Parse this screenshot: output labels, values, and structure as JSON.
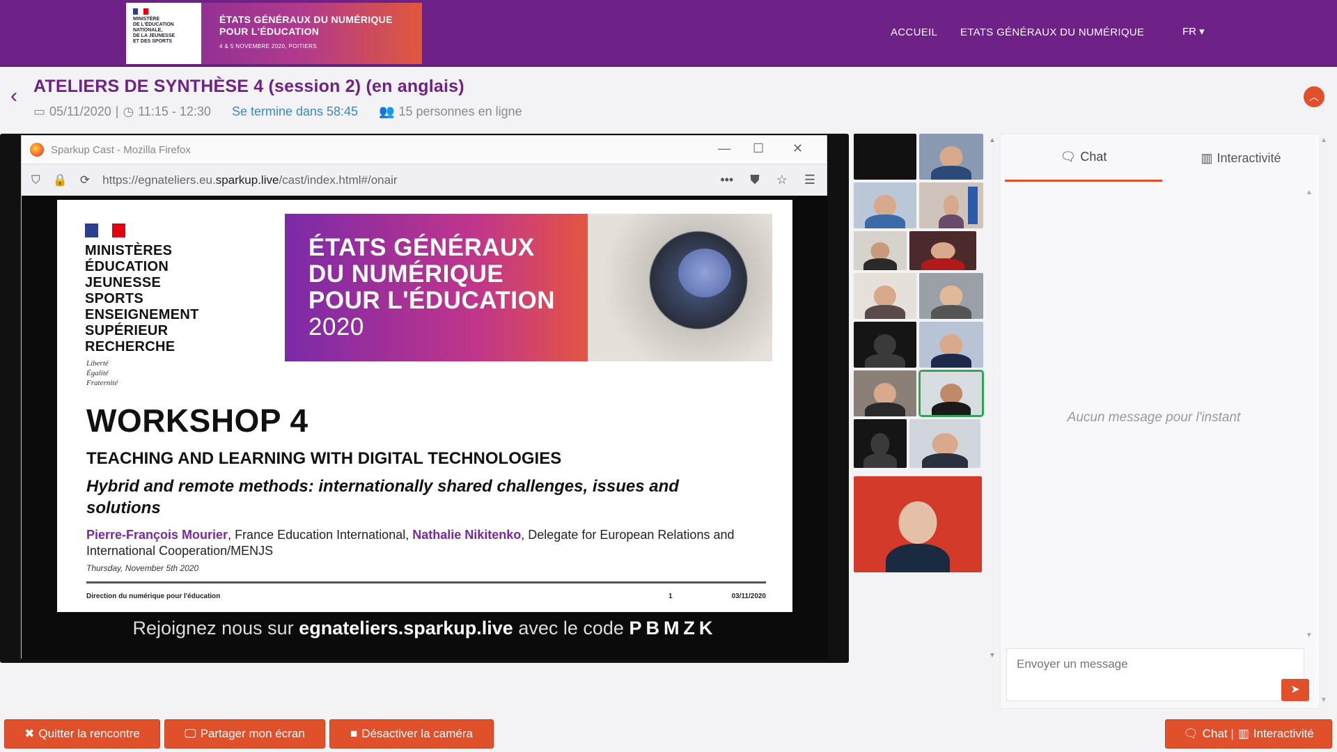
{
  "header": {
    "logo_ministry_lines": "MINISTÈRE\nDE L'ÉDUCATION\nNATIONALE,\nDE LA JEUNESSE\nET DES SPORTS",
    "logo_event_title": "ÉTATS GÉNÉRAUX DU NUMÉRIQUE\nPOUR L'ÉDUCATION",
    "logo_event_dates": "4 & 5 NOVEMBRE 2020, POITIERS",
    "nav": [
      "ACCUEIL",
      "ETATS GÉNÉRAUX DU NUMÉRIQUE"
    ],
    "lang": "FR ▾"
  },
  "session": {
    "title": "ATELIERS DE SYNTHÈSE 4 (session 2) (en anglais)",
    "date": "05/11/2020",
    "time": "11:15 - 12:30",
    "countdown": "Se termine dans 58:45",
    "online": "15 personnes en ligne"
  },
  "browser": {
    "window_title": "Sparkup Cast - Mozilla Firefox",
    "url_prefix": "https://egnateliers.eu.",
    "url_domain": "sparkup.live",
    "url_suffix": "/cast/index.html#/onair"
  },
  "slide": {
    "ministries": "MINISTÈRES\nÉDUCATION\nJEUNESSE\nSPORTS\nENSEIGNEMENT\nSUPÉRIEUR\nRECHERCHE",
    "devise": "Liberté\nÉgalité\nFraternité",
    "banner_title": "ÉTATS GÉNÉRAUX\nDU NUMÉRIQUE\nPOUR L'ÉDUCATION",
    "banner_year": "2020",
    "workshop": "WORKSHOP 4",
    "subtitle": "TEACHING AND LEARNING WITH DIGITAL TECHNOLOGIES",
    "italic_title": "Hybrid and remote methods: internationally shared challenges, issues and solutions",
    "speaker1": "Pierre-François Mourier",
    "speaker1_org": ", France Education International, ",
    "speaker2": "Nathalie Nikitenko",
    "speaker2_org": ", Delegate for European Relations and International Cooperation/MENJS",
    "date_line": "Thursday, November 5th 2020",
    "footer_left": "Direction du numérique pour l'éducation",
    "footer_page": "1",
    "footer_date": "03/11/2020"
  },
  "join": {
    "prefix": "Rejoignez nous sur ",
    "site": "egnateliers.sparkup.live",
    "middle": " avec le code ",
    "code": "PBMZK"
  },
  "chat": {
    "tab_chat": "Chat",
    "tab_interactivity": "Interactivité",
    "empty": "Aucun message pour l'instant",
    "placeholder": "Envoyer un message"
  },
  "buttons": {
    "quit": "Quitter la rencontre",
    "share": "Partager mon écran",
    "camera": "Désactiver la caméra",
    "chat_toggle": "Chat | ",
    "chat_toggle_b": "Interactivité"
  },
  "colors": {
    "brand_purple": "#6e2186",
    "accent_orange": "#e0502b",
    "countdown_blue": "#3d88c6"
  }
}
